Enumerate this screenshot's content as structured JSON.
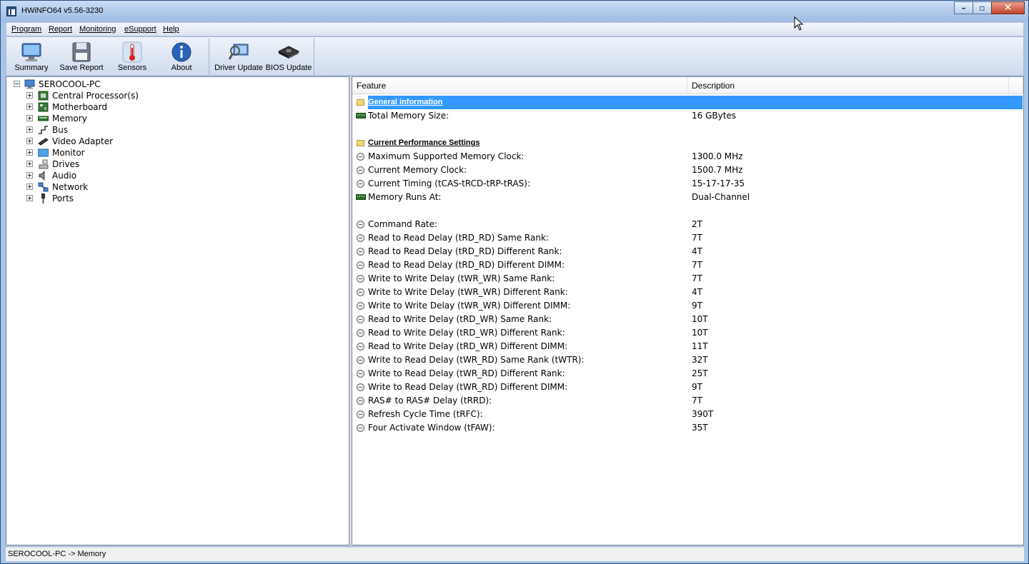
{
  "window": {
    "title": "HWiNFO64 v5.56-3230"
  },
  "menu": {
    "items": [
      {
        "label": "Program"
      },
      {
        "label": "Report"
      },
      {
        "label": "Monitoring"
      },
      {
        "label": "eSupport"
      },
      {
        "label": "Help"
      }
    ]
  },
  "toolbar": {
    "buttons": [
      {
        "label": "Summary",
        "icon": "monitor-icon"
      },
      {
        "label": "Save Report",
        "icon": "floppy-disk-icon"
      },
      {
        "label": "Sensors",
        "icon": "thermometer-icon"
      },
      {
        "label": "About",
        "icon": "info-icon"
      },
      {
        "label": "Driver Update",
        "icon": "magnifier-monitor-icon"
      },
      {
        "label": "BIOS Update",
        "icon": "chip-icon"
      }
    ]
  },
  "tree": {
    "root": "SEROCOOL-PC",
    "items": [
      {
        "label": "Central Processor(s)",
        "icon": "cpu-icon"
      },
      {
        "label": "Motherboard",
        "icon": "motherboard-icon"
      },
      {
        "label": "Memory",
        "icon": "memory-icon"
      },
      {
        "label": "Bus",
        "icon": "bus-icon"
      },
      {
        "label": "Video Adapter",
        "icon": "video-adapter-icon"
      },
      {
        "label": "Monitor",
        "icon": "monitor-icon"
      },
      {
        "label": "Drives",
        "icon": "drives-icon"
      },
      {
        "label": "Audio",
        "icon": "audio-icon"
      },
      {
        "label": "Network",
        "icon": "network-icon"
      },
      {
        "label": "Ports",
        "icon": "ports-icon"
      }
    ]
  },
  "table": {
    "headers": {
      "feature": "Feature",
      "description": "Description"
    },
    "rows": [
      {
        "type": "section",
        "feature": "General information",
        "description": "",
        "selected": true
      },
      {
        "type": "memory",
        "feature": "Total Memory Size:",
        "description": "16 GBytes"
      },
      {
        "type": "blank",
        "feature": "",
        "description": ""
      },
      {
        "type": "section",
        "feature": "Current Performance Settings",
        "description": ""
      },
      {
        "type": "item",
        "feature": "Maximum Supported Memory Clock:",
        "description": "1300.0 MHz"
      },
      {
        "type": "item",
        "feature": "Current Memory Clock:",
        "description": "1500.7 MHz"
      },
      {
        "type": "item",
        "feature": "Current Timing (tCAS-tRCD-tRP-tRAS):",
        "description": "15-17-17-35"
      },
      {
        "type": "memory",
        "feature": "Memory Runs At:",
        "description": "Dual-Channel"
      },
      {
        "type": "blank",
        "feature": "",
        "description": ""
      },
      {
        "type": "item",
        "feature": "Command Rate:",
        "description": "2T"
      },
      {
        "type": "item",
        "feature": "Read to Read Delay (tRD_RD) Same Rank:",
        "description": "7T"
      },
      {
        "type": "item",
        "feature": "Read to Read Delay (tRD_RD) Different Rank:",
        "description": "4T"
      },
      {
        "type": "item",
        "feature": "Read to Read Delay (tRD_RD) Different DIMM:",
        "description": "7T"
      },
      {
        "type": "item",
        "feature": "Write to Write Delay (tWR_WR) Same Rank:",
        "description": "7T"
      },
      {
        "type": "item",
        "feature": "Write to Write Delay (tWR_WR) Different Rank:",
        "description": "4T"
      },
      {
        "type": "item",
        "feature": "Write to Write Delay (tWR_WR) Different DIMM:",
        "description": "9T"
      },
      {
        "type": "item",
        "feature": "Read to Write Delay (tRD_WR) Same Rank:",
        "description": "10T"
      },
      {
        "type": "item",
        "feature": "Read to Write Delay (tRD_WR) Different Rank:",
        "description": "10T"
      },
      {
        "type": "item",
        "feature": "Read to Write Delay (tRD_WR) Different DIMM:",
        "description": "11T"
      },
      {
        "type": "item",
        "feature": "Write to Read Delay (tWR_RD) Same Rank (tWTR):",
        "description": "32T"
      },
      {
        "type": "item",
        "feature": "Write to Read Delay (tWR_RD) Different Rank:",
        "description": "25T"
      },
      {
        "type": "item",
        "feature": "Write to Read Delay (tWR_RD) Different DIMM:",
        "description": "9T"
      },
      {
        "type": "item",
        "feature": "RAS# to RAS# Delay (tRRD):",
        "description": "7T"
      },
      {
        "type": "item",
        "feature": "Refresh Cycle Time (tRFC):",
        "description": "390T"
      },
      {
        "type": "item",
        "feature": "Four Activate Window (tFAW):",
        "description": "35T"
      }
    ]
  },
  "statusbar": {
    "text": "SEROCOOL-PC -> Memory"
  },
  "colors": {
    "selection": "#3399ff",
    "titlebar": "#b9d1f0",
    "close": "#c3412c"
  }
}
